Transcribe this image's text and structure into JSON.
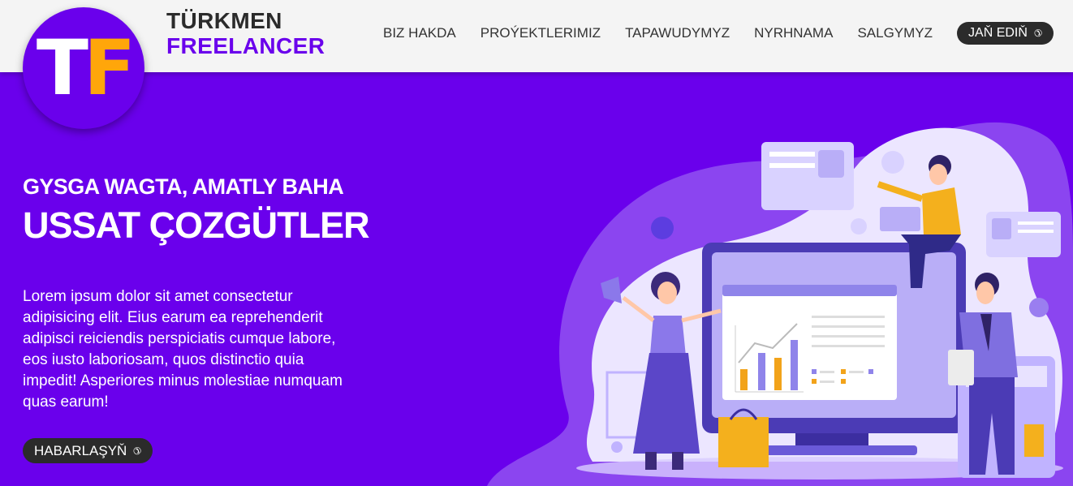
{
  "logo": {
    "letter1": "T",
    "letter2": "F"
  },
  "brand": {
    "line1": "TÜRKMEN",
    "line2": "FREELANCER"
  },
  "nav": {
    "items": [
      {
        "label": "BIZ HAKDA"
      },
      {
        "label": "PROÝEKTLERIMIZ"
      },
      {
        "label": "TAPAWUDYMYZ"
      },
      {
        "label": "NYRHNAMA"
      },
      {
        "label": "SALGYMYZ"
      }
    ],
    "cta_label": "JAŇ EDIŇ",
    "cta_icon": "phone-icon"
  },
  "hero": {
    "subtitle": "GYSGA WAGTA, AMATLY BAHA",
    "title": "USSAT ÇOZGÜTLER",
    "text": "Lorem ipsum dolor sit amet consectetur adipisicing elit. Eius earum ea reprehenderit adipisci reiciendis perspiciatis cumque labore, eos iusto laboriosam, quos distinctio quia impedit! Asperiores minus molestiae numquam quas earum!",
    "button_label": "HABARLAŞYŇ",
    "button_icon": "phone-icon"
  },
  "colors": {
    "brand": "#6a00ec",
    "accent": "#ffa60a",
    "dark": "#2b2b2b",
    "header_bg": "#f4f4f4"
  }
}
